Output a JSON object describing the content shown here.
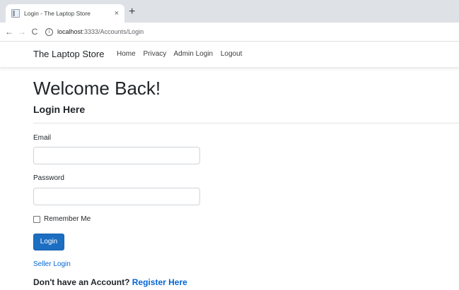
{
  "browser": {
    "tab_title": "Login - The Laptop Store",
    "tab_close": "×",
    "new_tab": "+",
    "back": "←",
    "forward": "→",
    "reload": "C",
    "url_host": "localhost",
    "url_path": ":3333/Accounts/Login"
  },
  "navbar": {
    "brand": "The Laptop Store",
    "links": [
      "Home",
      "Privacy",
      "Admin Login",
      "Logout"
    ]
  },
  "page": {
    "heading": "Welcome Back!",
    "subheading": "Login Here",
    "email_label": "Email",
    "email_value": "",
    "password_label": "Password",
    "password_value": "",
    "remember_label": "Remember Me",
    "login_button": "Login",
    "seller_link": "Seller Login",
    "register_prompt": "Don't have an Account?",
    "register_link": "Register Here"
  },
  "colors": {
    "primary_button": "#1b6ec2",
    "link": "#0366d6"
  }
}
